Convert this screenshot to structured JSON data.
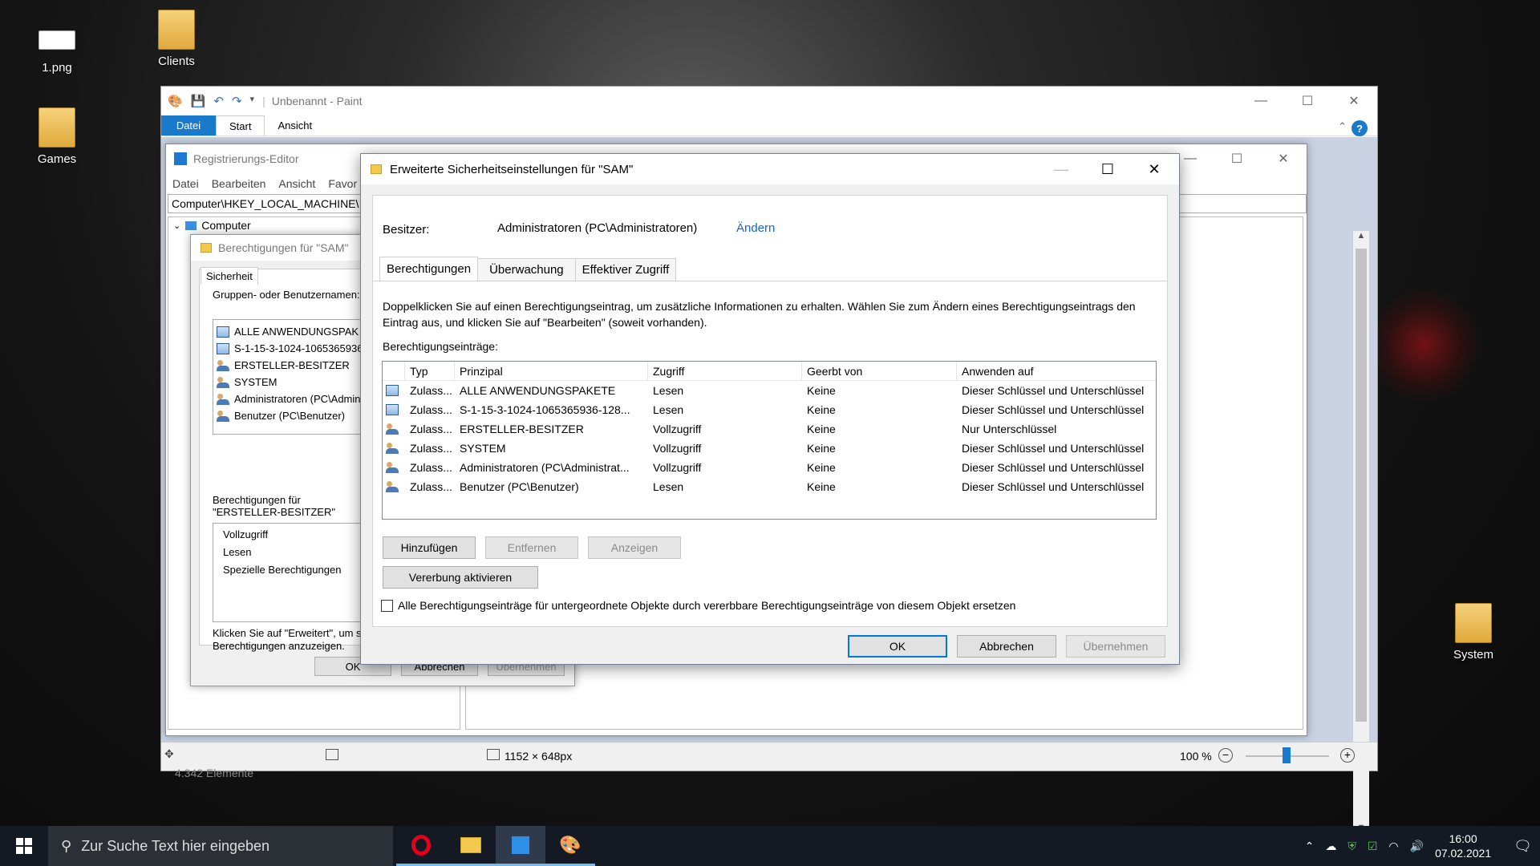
{
  "desktop": {
    "icons": [
      {
        "label": "1.png",
        "icon": "image-file-icon"
      },
      {
        "label": "Clients",
        "icon": "clients-folder-icon"
      },
      {
        "label": "Games",
        "icon": "games-folder-icon"
      },
      {
        "label": "System",
        "icon": "system-folder-icon"
      }
    ]
  },
  "paint": {
    "title": "Unbenannt - Paint",
    "tabs": [
      "Datei",
      "Start",
      "Ansicht"
    ],
    "status": {
      "dimensions": "1152 × 648px",
      "zoom": "100 %",
      "elements": "4.342 Elemente"
    }
  },
  "regedit": {
    "title": "Registrierungs-Editor",
    "menu": [
      "Datei",
      "Bearbeiten",
      "Ansicht",
      "Favor"
    ],
    "address": "Computer\\HKEY_LOCAL_MACHINE\\",
    "tree_root": "Computer"
  },
  "perm_dialog": {
    "title": "Berechtigungen für \"SAM\"",
    "tab": "Sicherheit",
    "groups_label": "Gruppen- oder Benutzernamen:",
    "groups": [
      {
        "name": "ALLE ANWENDUNGSPAK",
        "icon": "package-icon"
      },
      {
        "name": "S-1-15-3-1024-1065365936-",
        "icon": "package-icon"
      },
      {
        "name": "ERSTELLER-BESITZER",
        "icon": "user-group-icon"
      },
      {
        "name": "SYSTEM",
        "icon": "user-group-icon"
      },
      {
        "name": "Administratoren (PC\\Admin",
        "icon": "user-group-icon"
      },
      {
        "name": "Benutzer (PC\\Benutzer)",
        "icon": "user-group-icon"
      }
    ],
    "rights_label_1": "Berechtigungen für",
    "rights_label_2": "\"ERSTELLER-BESITZER\"",
    "rights": [
      "Vollzugriff",
      "Lesen",
      "Spezielle Berechtigungen"
    ],
    "hint_1": "Klicken Sie auf \"Erweitert\", um s",
    "hint_2": "Berechtigungen anzuzeigen.",
    "buttons": {
      "ok": "OK",
      "cancel": "Abbrechen",
      "apply": "Übernehmen"
    }
  },
  "advanced": {
    "title": "Erweiterte Sicherheitseinstellungen für \"SAM\"",
    "owner_label": "Besitzer:",
    "owner_value": "Administratoren (PC\\Administratoren)",
    "owner_change": "Ändern",
    "tabs": [
      "Berechtigungen",
      "Überwachung",
      "Effektiver Zugriff"
    ],
    "info": "Doppelklicken Sie auf einen Berechtigungseintrag, um zusätzliche Informationen zu erhalten. Wählen Sie zum Ändern eines Berechtigungseintrags den Eintrag aus, und klicken Sie auf \"Bearbeiten\" (soweit vorhanden).",
    "entries_label": "Berechtigungseinträge:",
    "columns": [
      "Typ",
      "Prinzipal",
      "Zugriff",
      "Geerbt von",
      "Anwenden auf"
    ],
    "rows": [
      {
        "icon": "package-icon",
        "typ": "Zulass...",
        "prinzipal": "ALLE ANWENDUNGSPAKETE",
        "zugriff": "Lesen",
        "geerbt": "Keine",
        "anwenden": "Dieser Schlüssel und Unterschlüssel"
      },
      {
        "icon": "package-icon",
        "typ": "Zulass...",
        "prinzipal": "S-1-15-3-1024-1065365936-128...",
        "zugriff": "Lesen",
        "geerbt": "Keine",
        "anwenden": "Dieser Schlüssel und Unterschlüssel"
      },
      {
        "icon": "user-group-icon",
        "typ": "Zulass...",
        "prinzipal": "ERSTELLER-BESITZER",
        "zugriff": "Vollzugriff",
        "geerbt": "Keine",
        "anwenden": "Nur Unterschlüssel"
      },
      {
        "icon": "user-group-icon",
        "typ": "Zulass...",
        "prinzipal": "SYSTEM",
        "zugriff": "Vollzugriff",
        "geerbt": "Keine",
        "anwenden": "Dieser Schlüssel und Unterschlüssel"
      },
      {
        "icon": "user-group-icon",
        "typ": "Zulass...",
        "prinzipal": "Administratoren (PC\\Administrat...",
        "zugriff": "Vollzugriff",
        "geerbt": "Keine",
        "anwenden": "Dieser Schlüssel und Unterschlüssel"
      },
      {
        "icon": "user-group-icon",
        "typ": "Zulass...",
        "prinzipal": "Benutzer (PC\\Benutzer)",
        "zugriff": "Lesen",
        "geerbt": "Keine",
        "anwenden": "Dieser Schlüssel und Unterschlüssel"
      }
    ],
    "btn_add": "Hinzufügen",
    "btn_remove": "Entfernen",
    "btn_view": "Anzeigen",
    "btn_inherit": "Vererbung aktivieren",
    "replace_checkbox": "Alle Berechtigungseinträge für untergeordnete Objekte durch vererbbare Berechtigungseinträge von diesem Objekt ersetzen",
    "replace_checked": false,
    "btn_ok": "OK",
    "btn_cancel": "Abbrechen",
    "btn_apply": "Übernehmen"
  },
  "taskbar": {
    "search_placeholder": "Zur Suche Text hier eingeben",
    "apps": [
      "opera-icon",
      "file-explorer-icon",
      "regedit-icon",
      "paint-icon"
    ],
    "time": "16:00",
    "date": "07.02.2021"
  }
}
